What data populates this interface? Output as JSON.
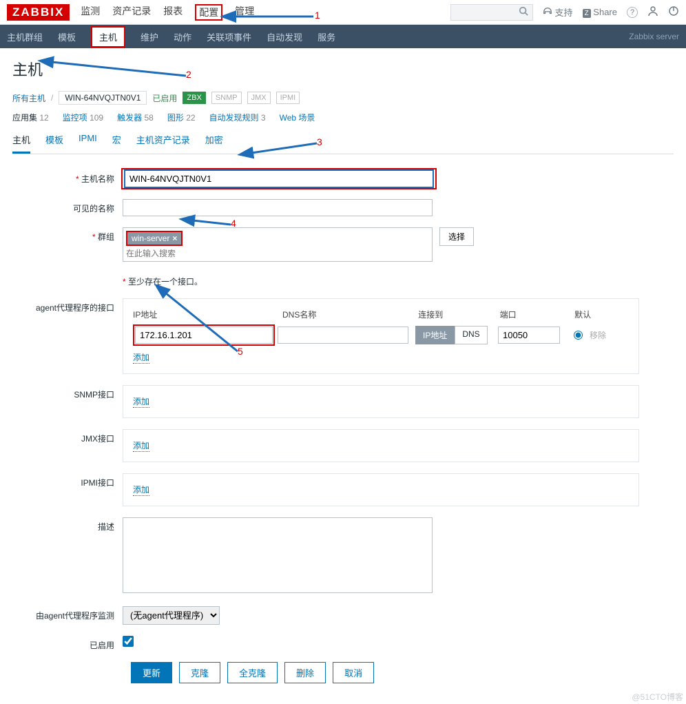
{
  "logo": "ZABBIX",
  "topnav": [
    "监测",
    "资产记录",
    "报表",
    "配置",
    "管理"
  ],
  "topnav_boxed_index": 3,
  "topright": {
    "support": "支持",
    "share": "Share"
  },
  "secnav": [
    "主机群组",
    "模板",
    "主机",
    "维护",
    "动作",
    "关联项事件",
    "自动发现",
    "服务"
  ],
  "secnav_active_index": 2,
  "server_label": "Zabbix server",
  "page_title": "主机",
  "breadcrumb": {
    "all_hosts": "所有主机",
    "current": "WIN-64NVQJTN0V1",
    "enabled": "已启用"
  },
  "proto_badges": [
    "ZBX",
    "SNMP",
    "JMX",
    "IPMI"
  ],
  "counts": [
    {
      "label": "应用集",
      "n": "12"
    },
    {
      "label": "监控项",
      "n": "109"
    },
    {
      "label": "触发器",
      "n": "58"
    },
    {
      "label": "图形",
      "n": "22"
    },
    {
      "label": "自动发现规则",
      "n": "3"
    },
    {
      "label": "Web 场景",
      "n": ""
    }
  ],
  "tabs": [
    "主机",
    "模板",
    "IPMI",
    "宏",
    "主机资产记录",
    "加密"
  ],
  "tabs_current_index": 0,
  "form": {
    "hostname_label": "主机名称",
    "hostname_value": "WIN-64NVQJTN0V1",
    "visible_label": "可见的名称",
    "visible_value": "",
    "groups_label": "群组",
    "group_chip": "win-server",
    "group_search_placeholder": "在此输入搜索",
    "select_btn": "选择",
    "iface_hint": "至少存在一个接口。",
    "agent_iface_label": "agent代理程序的接口",
    "hdr_ip": "IP地址",
    "hdr_dns": "DNS名称",
    "hdr_conn": "连接到",
    "hdr_port": "端口",
    "hdr_default": "默认",
    "ip_value": "172.16.1.201",
    "dns_value": "",
    "conn_ip": "IP地址",
    "conn_dns": "DNS",
    "port_value": "10050",
    "remove": "移除",
    "add": "添加",
    "snmp_label": "SNMP接口",
    "jmx_label": "JMX接口",
    "ipmi_label": "IPMI接口",
    "desc_label": "描述",
    "desc_value": "",
    "proxy_label": "由agent代理程序监测",
    "proxy_value": "(无agent代理程序)",
    "enabled_label": "已启用"
  },
  "buttons": {
    "update": "更新",
    "clone": "克隆",
    "full_clone": "全克隆",
    "delete": "删除",
    "cancel": "取消"
  },
  "annotations": {
    "n1": "1",
    "n2": "2",
    "n3": "3",
    "n4": "4",
    "n5": "5"
  },
  "watermark": "@51CTO博客"
}
